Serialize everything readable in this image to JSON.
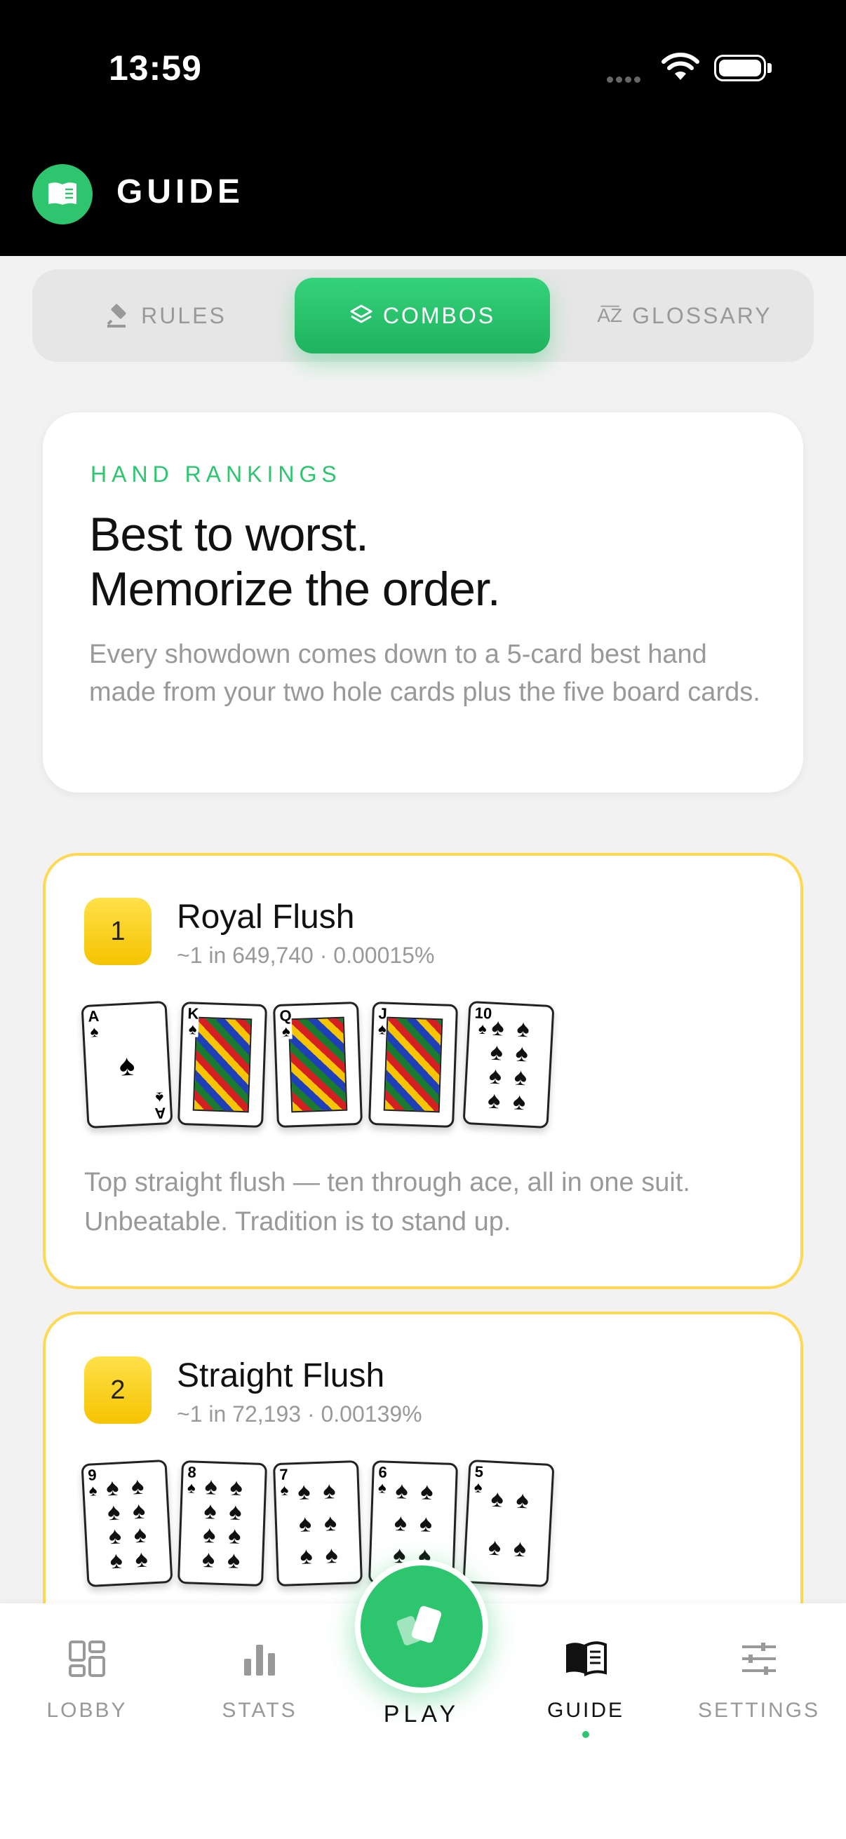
{
  "status": {
    "time": "13:59"
  },
  "header": {
    "title": "GUIDE",
    "icon": "book-icon"
  },
  "tabs": [
    {
      "label": "RULES",
      "icon": "gavel-icon",
      "active": false
    },
    {
      "label": "COMBOS",
      "icon": "layers-icon",
      "active": true
    },
    {
      "label": "GLOSSARY",
      "icon": "az-icon",
      "active": false
    }
  ],
  "intro": {
    "eyebrow": "HAND RANKINGS",
    "headline_line1": "Best to worst.",
    "headline_line2": "Memorize the order.",
    "body": "Every showdown comes down to a 5-card best hand made from your two hole cards plus the five board cards."
  },
  "hands": [
    {
      "rank": "1",
      "name": "Royal Flush",
      "odds": "~1 in 649,740 · 0.00015%",
      "cards": [
        "A",
        "K",
        "Q",
        "J",
        "10"
      ],
      "description": "Top straight flush — ten through ace, all in one suit. Unbeatable. Tradition is to stand up."
    },
    {
      "rank": "2",
      "name": "Straight Flush",
      "odds": "~1 in 72,193 · 0.00139%",
      "cards": [
        "9",
        "8",
        "7",
        "6",
        "5"
      ]
    }
  ],
  "nav": {
    "lobby": "LOBBY",
    "stats": "STATS",
    "play": "PLAY",
    "guide": "GUIDE",
    "settings": "SETTINGS"
  },
  "colors": {
    "accent": "#2dc66f",
    "rank_gold": "#f5c300",
    "border_gold": "#ffd954"
  }
}
